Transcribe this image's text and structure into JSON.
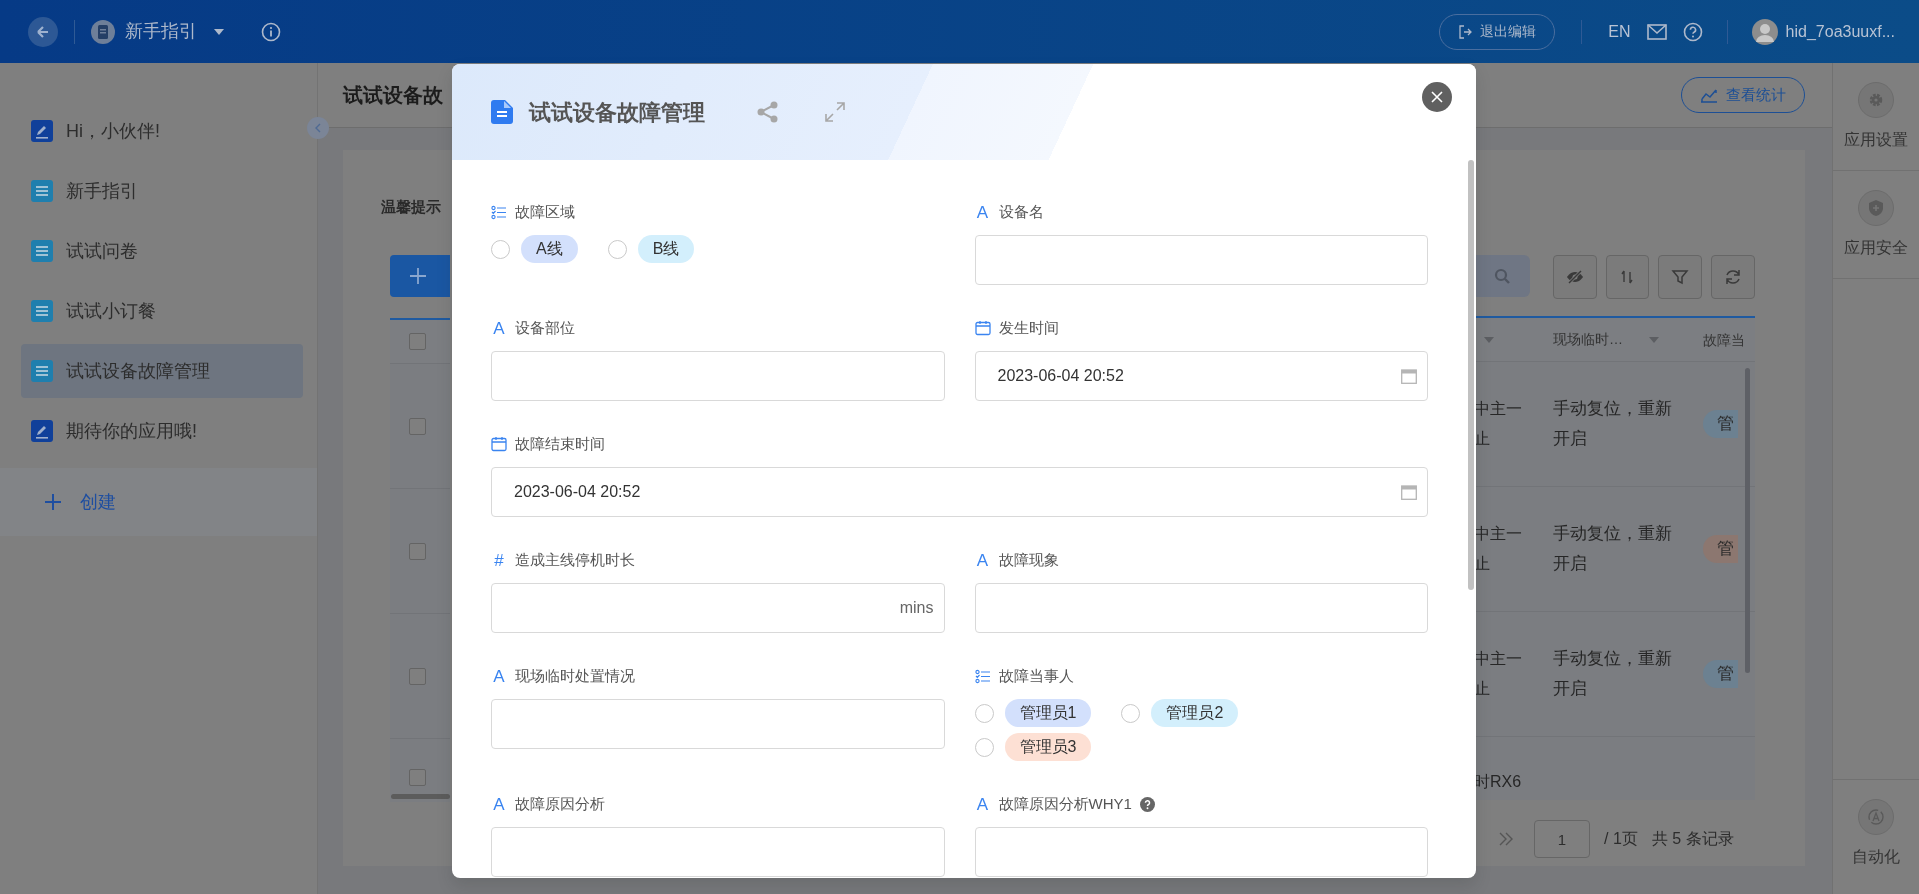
{
  "topbar": {
    "app_title": "新手指引",
    "exit_button": "退出编辑",
    "language": "EN",
    "username": "hid_7oa3uuxf..."
  },
  "sidebar": {
    "items": [
      {
        "label": "Hi，小伙伴!",
        "kind": "note",
        "selected": false
      },
      {
        "label": "新手指引",
        "kind": "list",
        "selected": false
      },
      {
        "label": "试试问卷",
        "kind": "list",
        "selected": false
      },
      {
        "label": "试试小订餐",
        "kind": "list",
        "selected": false
      },
      {
        "label": "试试设备故障管理",
        "kind": "list",
        "selected": true
      },
      {
        "label": "期待你的应用哦!",
        "kind": "note",
        "selected": false
      }
    ],
    "create": "创建"
  },
  "page": {
    "title": "试试设备故",
    "stats_button": "查看统计",
    "tip": "温馨提示",
    "select_all": {
      "checked": false
    },
    "columns": [
      "",
      "现场临时…",
      "故障当"
    ],
    "rows": [
      {
        "checked": false,
        "cells": [
          "中主一止",
          "手动复位，重新开启"
        ],
        "tag": {
          "text": "管",
          "color": "#6c8191"
        }
      },
      {
        "checked": false,
        "cells": [
          "中主一止",
          "手动复位，重新开启"
        ],
        "tag": {
          "text": "管",
          "color": "#8c7770"
        }
      },
      {
        "checked": false,
        "cells": [
          "中主一止",
          "手动复位，重新开启"
        ],
        "tag": {
          "text": "管",
          "color": "#6c8191"
        }
      },
      {
        "checked": false,
        "cells": [
          "时RX6"
        ]
      }
    ],
    "pagination": {
      "page": "1",
      "pages": "/ 1页",
      "total": "共 5 条记录"
    }
  },
  "right_panel": [
    {
      "label": "应用设置",
      "kind": "settings"
    },
    {
      "label": "应用安全",
      "kind": "security"
    },
    {
      "label": "自动化",
      "kind": "automation"
    }
  ],
  "modal": {
    "title": "试试设备故障管理",
    "fields": [
      {
        "kind": "choice",
        "label": "故障区域",
        "options": [
          {
            "label": "A线",
            "color": "#d3e0fc",
            "selected": false
          },
          {
            "label": "B线",
            "color": "#d3effc",
            "selected": false
          }
        ]
      },
      {
        "kind": "text",
        "icon": "A",
        "label": "设备名"
      },
      {
        "kind": "text",
        "icon": "A",
        "label": "设备部位"
      },
      {
        "kind": "date",
        "label": "发生时间",
        "value": "2023-06-04 20:52"
      },
      {
        "kind": "date",
        "label": "故障结束时间",
        "value": "2023-06-04 20:52",
        "wide": true
      },
      {
        "kind": "number",
        "icon": "#",
        "label": "造成主线停机时长",
        "suffix": "mins"
      },
      {
        "kind": "text",
        "icon": "A",
        "label": "故障现象"
      },
      {
        "kind": "text",
        "icon": "A",
        "label": "现场临时处置情况"
      },
      {
        "kind": "choice",
        "label": "故障当事人",
        "options": [
          {
            "label": "管理员1",
            "color": "#d3e0fc",
            "selected": false
          },
          {
            "label": "管理员2",
            "color": "#d3effc",
            "selected": false
          },
          {
            "label": "管理员3",
            "color": "#fde0d4",
            "selected": false
          }
        ]
      },
      {
        "kind": "text",
        "icon": "A",
        "label": "故障原因分析"
      },
      {
        "kind": "text",
        "icon": "A",
        "label": "故障原因分析WHY1",
        "help": true
      }
    ]
  }
}
